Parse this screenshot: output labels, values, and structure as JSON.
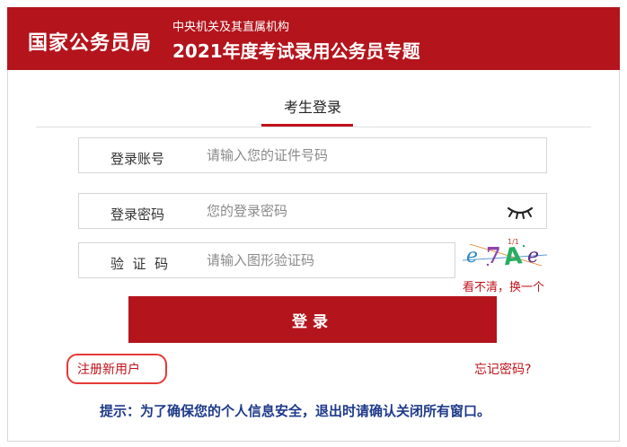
{
  "header": {
    "brand": "国家公务员局",
    "org": "中央机关及其直属机构",
    "topic": "2021年度考试录用公务员专题"
  },
  "tabs": {
    "active": "考生登录"
  },
  "form": {
    "account": {
      "label": "登录账号",
      "placeholder": "请输入您的证件号码"
    },
    "password": {
      "label": "登录密码",
      "placeholder": "您的登录密码"
    },
    "captcha": {
      "label": "验  证  码",
      "placeholder": "请输入图形验证码",
      "image_text": "e7Ae",
      "refresh": "看不清，换一个"
    },
    "login_button": "登录"
  },
  "links": {
    "register": "注册新用户",
    "forgot": "忘记密码?"
  },
  "notice": "提示：为了确保您的个人信息安全，退出时请确认关闭所有窗口。",
  "colors": {
    "brand_red": "#b4141c",
    "notice_blue": "#1e3a8a",
    "highlight": "#e53935"
  },
  "icons": {
    "password_toggle": "eye-closed-icon"
  }
}
